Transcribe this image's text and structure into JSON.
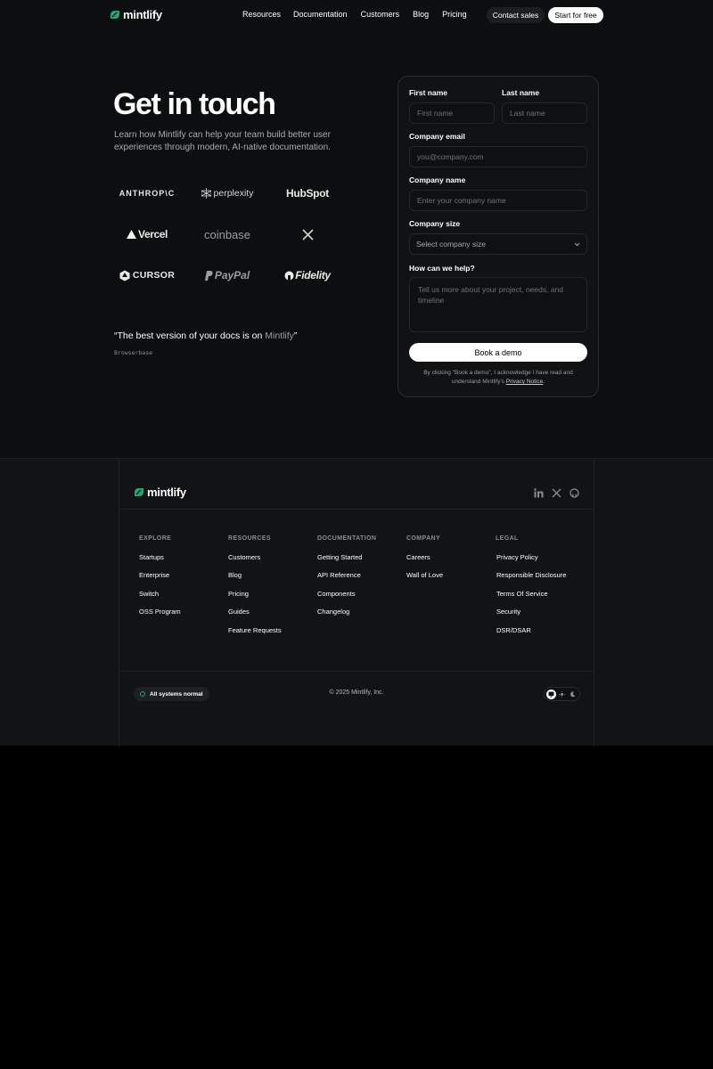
{
  "header": {
    "brand": "mintlify",
    "nav": [
      "Resources",
      "Documentation",
      "Customers",
      "Blog",
      "Pricing"
    ],
    "contact_label": "Contact sales",
    "start_label": "Start for free"
  },
  "hero": {
    "title": "Get in touch",
    "subtitle": "Learn how Mintlify can help your team build better user experiences through modern, AI-native documentation.",
    "customer_logos": [
      "ANTHROP\\C",
      "perplexity",
      "HubSpot",
      "Vercel",
      "coinbase",
      "X",
      "CURSOR",
      "PayPal",
      "Fidelity"
    ],
    "quote_prefix": "“The best version of your docs is on ",
    "quote_brand": "Mintlify",
    "quote_suffix": "”",
    "quote_author": "Browserbase"
  },
  "form": {
    "first_name_label": "First name",
    "first_name_placeholder": "First name",
    "last_name_label": "Last name",
    "last_name_placeholder": "Last name",
    "email_label": "Company email",
    "email_placeholder": "you@company.com",
    "company_label": "Company name",
    "company_placeholder": "Enter your company name",
    "size_label": "Company size",
    "size_value": "Select company size",
    "help_label": "How can we help?",
    "help_placeholder": "Tell us more about your project, needs, and timeline",
    "submit_label": "Book a demo",
    "legal_text": "By clicking \"Book a demo\", I acknowledge I have read and understand Mintlify's ",
    "legal_link": "Privacy Notice",
    "legal_end": "."
  },
  "footer": {
    "brand": "mintlify",
    "social_icons": [
      "linkedin-icon",
      "x-icon",
      "github-icon"
    ],
    "columns": [
      {
        "heading": "EXPLORE",
        "links": [
          "Startups",
          "Enterprise",
          "Switch",
          "OSS Program"
        ]
      },
      {
        "heading": "RESOURCES",
        "links": [
          "Customers",
          "Blog",
          "Pricing",
          "Guides",
          "Feature Requests"
        ]
      },
      {
        "heading": "DOCUMENTATION",
        "links": [
          "Getting Started",
          "API Reference",
          "Components",
          "Changelog"
        ]
      },
      {
        "heading": "COMPANY",
        "links": [
          "Careers",
          "Wall of Love"
        ]
      },
      {
        "heading": "LEGAL",
        "links": [
          "Privacy Policy",
          "Responsible Disclosure",
          "Terms Of Service",
          "Security",
          "DSR/DSAR"
        ]
      }
    ],
    "status": "All systems normal",
    "copyright": "© 2025 Mintlify, Inc.",
    "theme_options": [
      "system",
      "light",
      "dark"
    ]
  },
  "colors": {
    "brand_green": "#1fa870",
    "hero_bg": "#0d0e0f",
    "footer_bg": "#121315",
    "page_bg": "#000000"
  }
}
